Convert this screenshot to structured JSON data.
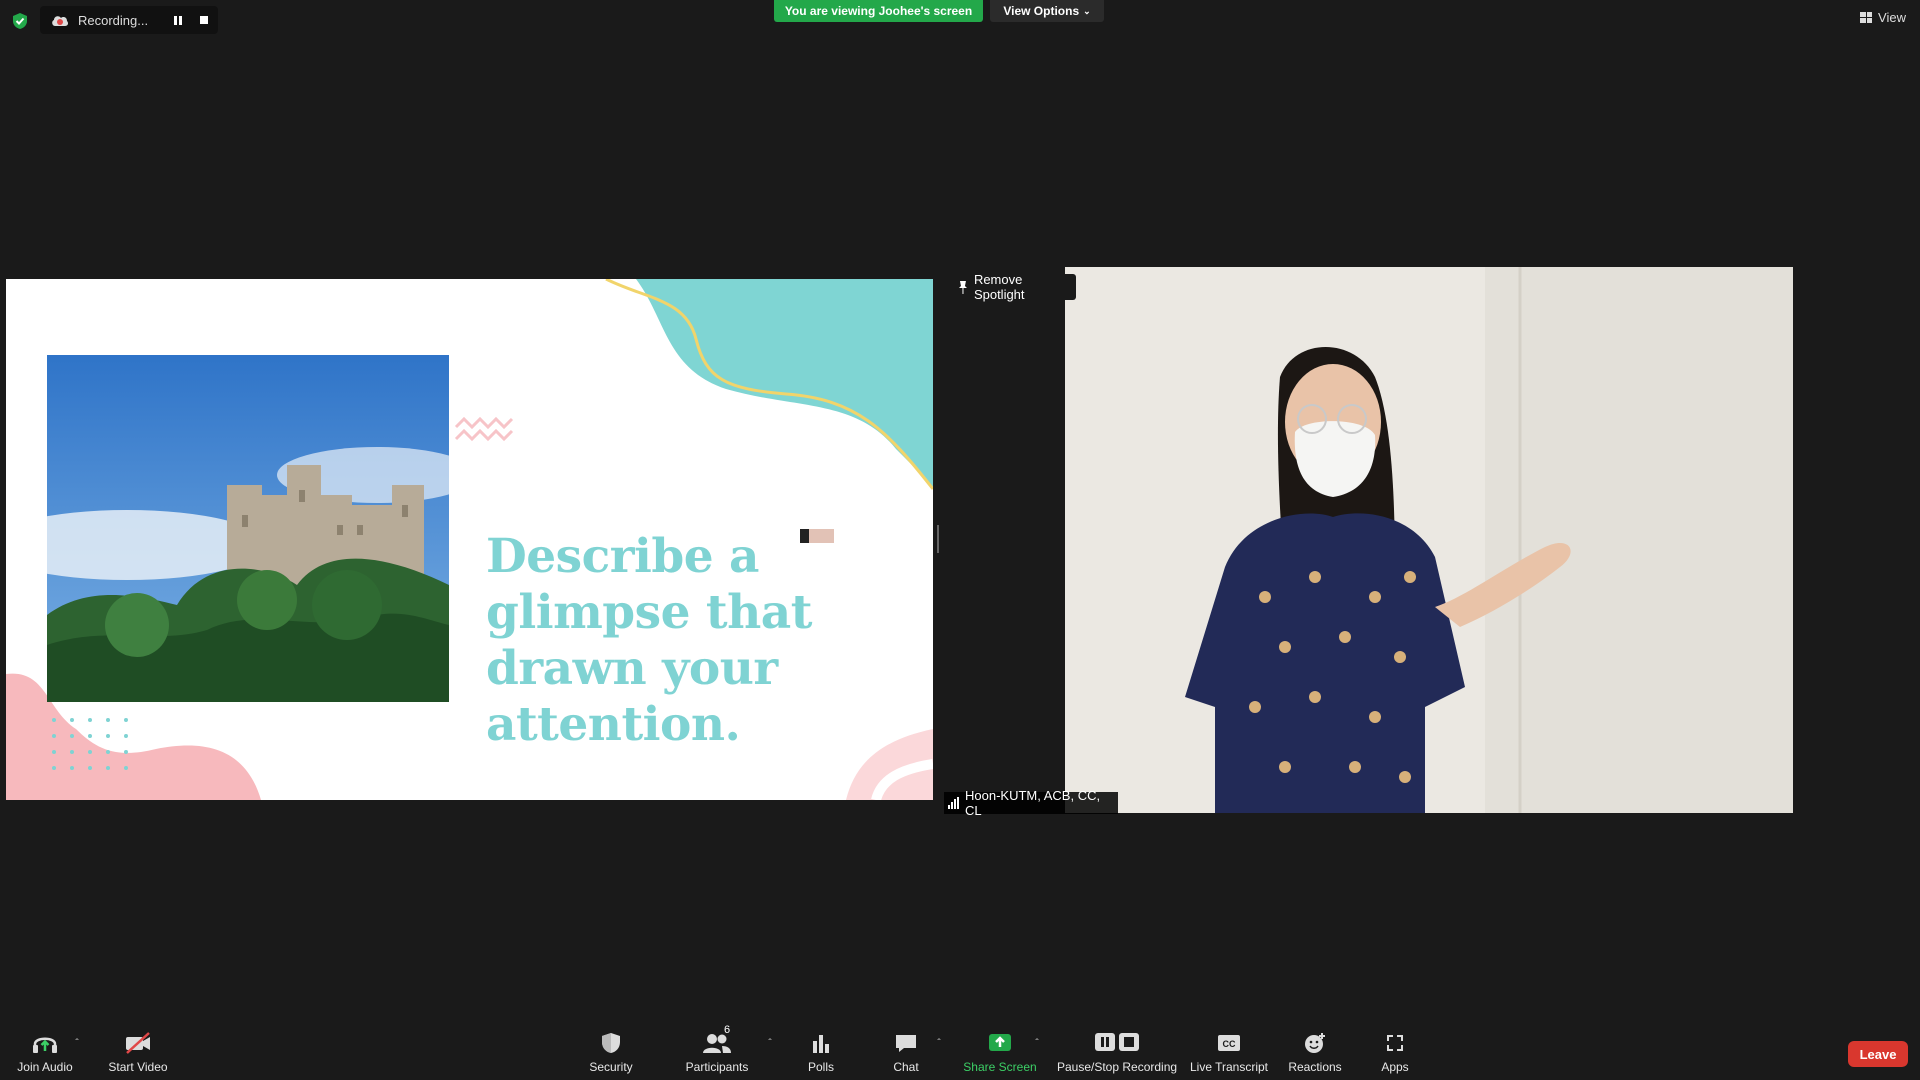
{
  "recording": {
    "label": "Recording..."
  },
  "banner": {
    "viewing_text": "You are viewing Joohee's screen",
    "view_options": "View Options"
  },
  "view_button": {
    "label": "View"
  },
  "slide": {
    "title": "Describe a glimpse that drawn your attention."
  },
  "spotlight": {
    "label": "Remove Spotlight"
  },
  "participant": {
    "name": "Hoon-KUTM, ACB, CC, CL"
  },
  "toolbar": {
    "join_audio": "Join Audio",
    "start_video": "Start Video",
    "security": "Security",
    "participants": "Participants",
    "participants_count": "6",
    "polls": "Polls",
    "chat": "Chat",
    "share_screen": "Share Screen",
    "pause_stop_recording": "Pause/Stop Recording",
    "live_transcript": "Live Transcript",
    "reactions": "Reactions",
    "apps": "Apps",
    "leave": "Leave"
  },
  "colors": {
    "banner_green": "#23a84a",
    "share_green": "#3ccf66",
    "leave_red": "#d9372e",
    "slide_teal": "#7fd3d3",
    "slide_pink": "#f7b9bd"
  }
}
